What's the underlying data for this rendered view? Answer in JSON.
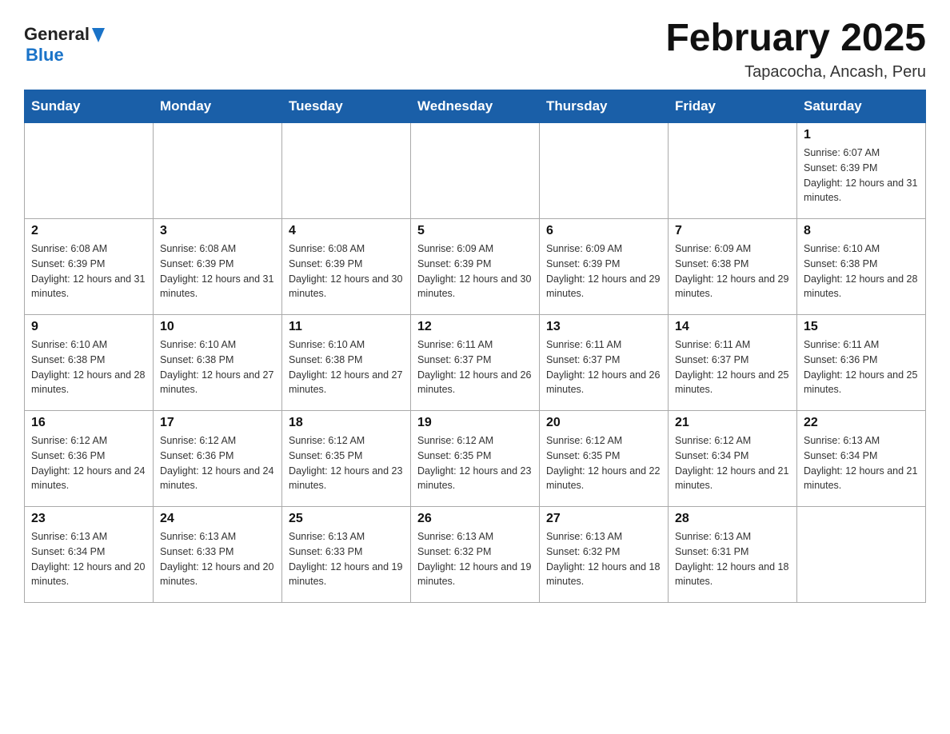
{
  "header": {
    "logo_general": "General",
    "logo_blue": "Blue",
    "title": "February 2025",
    "subtitle": "Tapacocha, Ancash, Peru"
  },
  "days_of_week": [
    "Sunday",
    "Monday",
    "Tuesday",
    "Wednesday",
    "Thursday",
    "Friday",
    "Saturday"
  ],
  "weeks": [
    [
      {
        "day": "",
        "info": ""
      },
      {
        "day": "",
        "info": ""
      },
      {
        "day": "",
        "info": ""
      },
      {
        "day": "",
        "info": ""
      },
      {
        "day": "",
        "info": ""
      },
      {
        "day": "",
        "info": ""
      },
      {
        "day": "1",
        "info": "Sunrise: 6:07 AM\nSunset: 6:39 PM\nDaylight: 12 hours and 31 minutes."
      }
    ],
    [
      {
        "day": "2",
        "info": "Sunrise: 6:08 AM\nSunset: 6:39 PM\nDaylight: 12 hours and 31 minutes."
      },
      {
        "day": "3",
        "info": "Sunrise: 6:08 AM\nSunset: 6:39 PM\nDaylight: 12 hours and 31 minutes."
      },
      {
        "day": "4",
        "info": "Sunrise: 6:08 AM\nSunset: 6:39 PM\nDaylight: 12 hours and 30 minutes."
      },
      {
        "day": "5",
        "info": "Sunrise: 6:09 AM\nSunset: 6:39 PM\nDaylight: 12 hours and 30 minutes."
      },
      {
        "day": "6",
        "info": "Sunrise: 6:09 AM\nSunset: 6:39 PM\nDaylight: 12 hours and 29 minutes."
      },
      {
        "day": "7",
        "info": "Sunrise: 6:09 AM\nSunset: 6:38 PM\nDaylight: 12 hours and 29 minutes."
      },
      {
        "day": "8",
        "info": "Sunrise: 6:10 AM\nSunset: 6:38 PM\nDaylight: 12 hours and 28 minutes."
      }
    ],
    [
      {
        "day": "9",
        "info": "Sunrise: 6:10 AM\nSunset: 6:38 PM\nDaylight: 12 hours and 28 minutes."
      },
      {
        "day": "10",
        "info": "Sunrise: 6:10 AM\nSunset: 6:38 PM\nDaylight: 12 hours and 27 minutes."
      },
      {
        "day": "11",
        "info": "Sunrise: 6:10 AM\nSunset: 6:38 PM\nDaylight: 12 hours and 27 minutes."
      },
      {
        "day": "12",
        "info": "Sunrise: 6:11 AM\nSunset: 6:37 PM\nDaylight: 12 hours and 26 minutes."
      },
      {
        "day": "13",
        "info": "Sunrise: 6:11 AM\nSunset: 6:37 PM\nDaylight: 12 hours and 26 minutes."
      },
      {
        "day": "14",
        "info": "Sunrise: 6:11 AM\nSunset: 6:37 PM\nDaylight: 12 hours and 25 minutes."
      },
      {
        "day": "15",
        "info": "Sunrise: 6:11 AM\nSunset: 6:36 PM\nDaylight: 12 hours and 25 minutes."
      }
    ],
    [
      {
        "day": "16",
        "info": "Sunrise: 6:12 AM\nSunset: 6:36 PM\nDaylight: 12 hours and 24 minutes."
      },
      {
        "day": "17",
        "info": "Sunrise: 6:12 AM\nSunset: 6:36 PM\nDaylight: 12 hours and 24 minutes."
      },
      {
        "day": "18",
        "info": "Sunrise: 6:12 AM\nSunset: 6:35 PM\nDaylight: 12 hours and 23 minutes."
      },
      {
        "day": "19",
        "info": "Sunrise: 6:12 AM\nSunset: 6:35 PM\nDaylight: 12 hours and 23 minutes."
      },
      {
        "day": "20",
        "info": "Sunrise: 6:12 AM\nSunset: 6:35 PM\nDaylight: 12 hours and 22 minutes."
      },
      {
        "day": "21",
        "info": "Sunrise: 6:12 AM\nSunset: 6:34 PM\nDaylight: 12 hours and 21 minutes."
      },
      {
        "day": "22",
        "info": "Sunrise: 6:13 AM\nSunset: 6:34 PM\nDaylight: 12 hours and 21 minutes."
      }
    ],
    [
      {
        "day": "23",
        "info": "Sunrise: 6:13 AM\nSunset: 6:34 PM\nDaylight: 12 hours and 20 minutes."
      },
      {
        "day": "24",
        "info": "Sunrise: 6:13 AM\nSunset: 6:33 PM\nDaylight: 12 hours and 20 minutes."
      },
      {
        "day": "25",
        "info": "Sunrise: 6:13 AM\nSunset: 6:33 PM\nDaylight: 12 hours and 19 minutes."
      },
      {
        "day": "26",
        "info": "Sunrise: 6:13 AM\nSunset: 6:32 PM\nDaylight: 12 hours and 19 minutes."
      },
      {
        "day": "27",
        "info": "Sunrise: 6:13 AM\nSunset: 6:32 PM\nDaylight: 12 hours and 18 minutes."
      },
      {
        "day": "28",
        "info": "Sunrise: 6:13 AM\nSunset: 6:31 PM\nDaylight: 12 hours and 18 minutes."
      },
      {
        "day": "",
        "info": ""
      }
    ]
  ]
}
